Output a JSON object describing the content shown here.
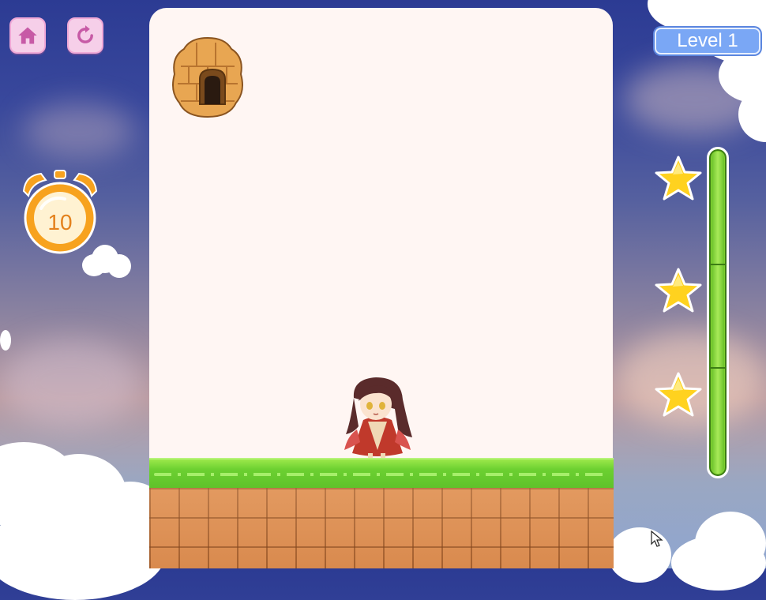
{
  "hud": {
    "home_icon": "home-icon",
    "restart_icon": "restart-icon",
    "timer": {
      "icon": "alarm-clock-icon",
      "value": "10"
    },
    "level_label": "Level 1"
  },
  "progress": {
    "fill_fraction": 1.0,
    "stars": [
      {
        "icon": "star-icon",
        "filled": true
      },
      {
        "icon": "star-icon",
        "filled": true
      },
      {
        "icon": "star-icon",
        "filled": true
      }
    ]
  },
  "scene": {
    "goal": "beehive-icon",
    "player": "girl-character",
    "ground": "grass-platform",
    "floor": "brick-ground"
  },
  "colors": {
    "button_bg": "#f6cfe9",
    "button_icon": "#c75aa6",
    "timer_orange": "#f7a21e",
    "level_bg": "#7aa7f5",
    "grass": "#6cd031",
    "brick": "#d98a4e",
    "star": "#ffd21f",
    "board": "#fff6f3"
  }
}
